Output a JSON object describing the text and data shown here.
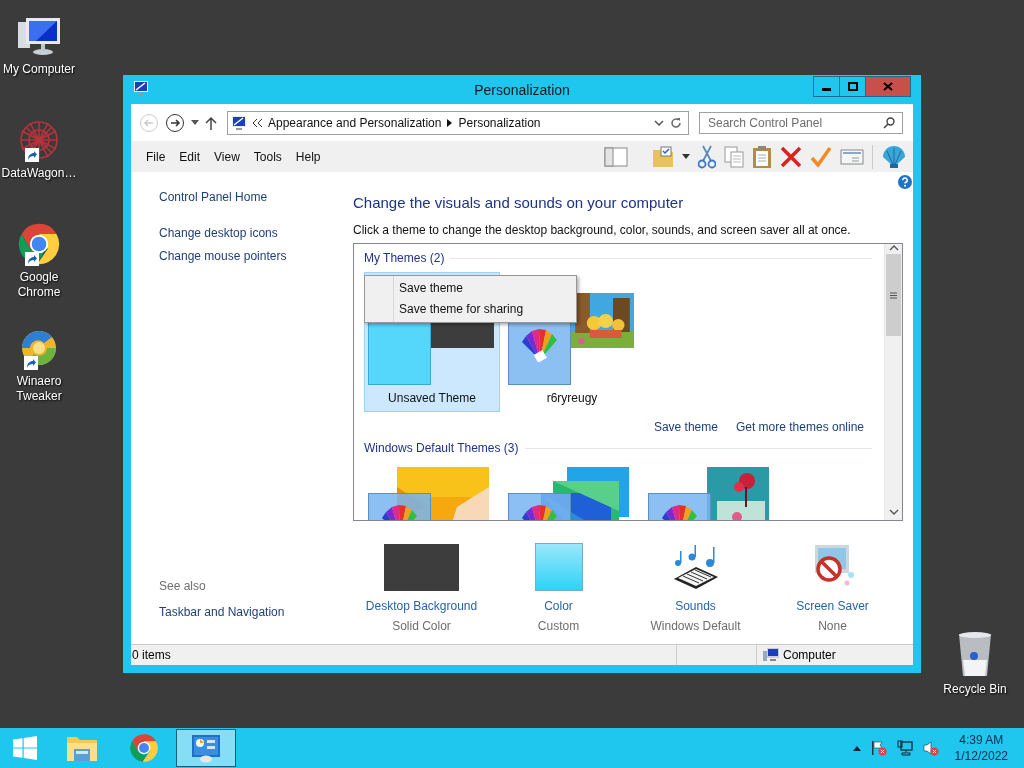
{
  "desktop_icons": [
    {
      "label": "My Computer",
      "kind": "computer",
      "shortcut": false
    },
    {
      "label": "DataWagon…",
      "kind": "datawagon",
      "shortcut": true
    },
    {
      "label": "Google Chrome",
      "kind": "chrome",
      "shortcut": true
    },
    {
      "label": "Winaero Tweaker",
      "kind": "winaero",
      "shortcut": true
    }
  ],
  "recycle_bin": {
    "label": "Recycle Bin"
  },
  "window": {
    "title": "Personalization"
  },
  "address_bar": {
    "path": [
      "Appearance and Personalization",
      "Personalization"
    ]
  },
  "search": {
    "placeholder": "Search Control Panel"
  },
  "menu": [
    "File",
    "Edit",
    "View",
    "Tools",
    "Help"
  ],
  "sidebar": {
    "links": [
      "Control Panel Home",
      "Change desktop icons",
      "Change mouse pointers"
    ],
    "see_also_title": "See also",
    "see_also": [
      "Taskbar and Navigation"
    ]
  },
  "heading": "Change the visuals and sounds on your computer",
  "description": "Click a theme to change the desktop background, color, sounds, and screen saver all at once.",
  "theme_groups": [
    {
      "title": "My Themes (2)",
      "themes": [
        {
          "name": "Unsaved Theme",
          "kind": "solid",
          "selected": true
        },
        {
          "name": "r6ryreugy",
          "kind": "cartoon",
          "selected": false
        }
      ],
      "links": [
        "Save theme",
        "Get more themes online"
      ]
    },
    {
      "title": "Windows Default Themes (3)",
      "themes": [
        {
          "kind": "windows",
          "selected": false
        },
        {
          "kind": "lines",
          "selected": false
        },
        {
          "kind": "flowers",
          "selected": false
        }
      ]
    }
  ],
  "context_menu": [
    "Save theme",
    "Save theme for sharing"
  ],
  "settings": [
    {
      "label": "Desktop Background",
      "value": "Solid Color",
      "kind": "background"
    },
    {
      "label": "Color",
      "value": "Custom",
      "kind": "color"
    },
    {
      "label": "Sounds",
      "value": "Windows Default",
      "kind": "sounds"
    },
    {
      "label": "Screen Saver",
      "value": "None",
      "kind": "screensaver"
    }
  ],
  "status_bar": {
    "items": "0 items",
    "location": "Computer"
  },
  "taskbar": {
    "apps": [
      {
        "kind": "explorer",
        "selected": false
      },
      {
        "kind": "chrome",
        "selected": false
      },
      {
        "kind": "control-panel",
        "selected": true
      }
    ],
    "time": "4:39 AM",
    "date": "1/12/2022"
  }
}
